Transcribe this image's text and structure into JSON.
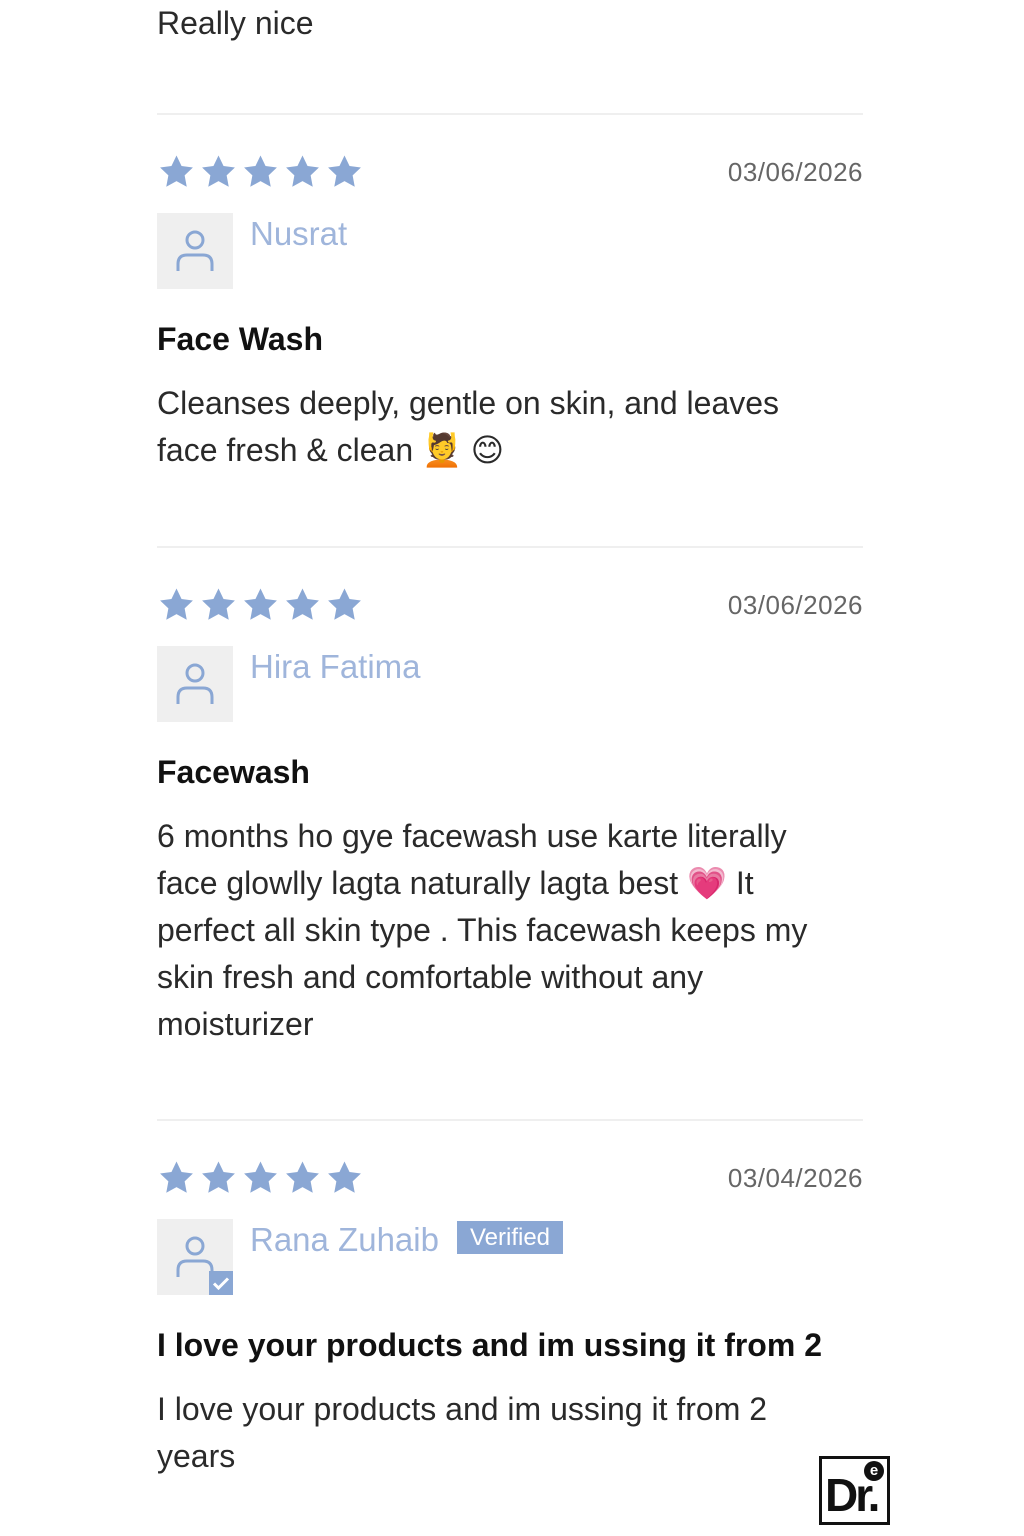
{
  "previous_review": {
    "body": "Really nice"
  },
  "reviews": [
    {
      "rating": 5,
      "date": "03/06/2026",
      "author": "Nusrat",
      "verified": false,
      "title": "Face Wash",
      "body_lines": [
        "Cleanses deeply, gentle on skin, and leaves",
        "face fresh & clean 💆 😊"
      ]
    },
    {
      "rating": 5,
      "date": "03/06/2026",
      "author": "Hira Fatima",
      "verified": false,
      "title": "Facewash",
      "body_lines": [
        "6 months ho gye facewash use karte literally",
        "face glowlly lagta naturally lagta best 💗 It",
        "perfect all skin type . This facewash keeps my",
        "skin fresh and comfortable without any",
        "moisturizer"
      ]
    },
    {
      "rating": 5,
      "date": "03/04/2026",
      "author": "Rana Zuhaib",
      "verified": true,
      "verified_label": "Verified",
      "title": "I love your products and im ussing it from 2",
      "body_lines": [
        "I love your products and im ussing it from 2",
        "years"
      ]
    }
  ],
  "colors": {
    "star": "#8aa7d4",
    "author": "#9fb5db",
    "verified_bg": "#8aa7d4",
    "avatar_bg": "#efefef"
  },
  "logo": {
    "text": "Dr.",
    "badge": "e"
  }
}
